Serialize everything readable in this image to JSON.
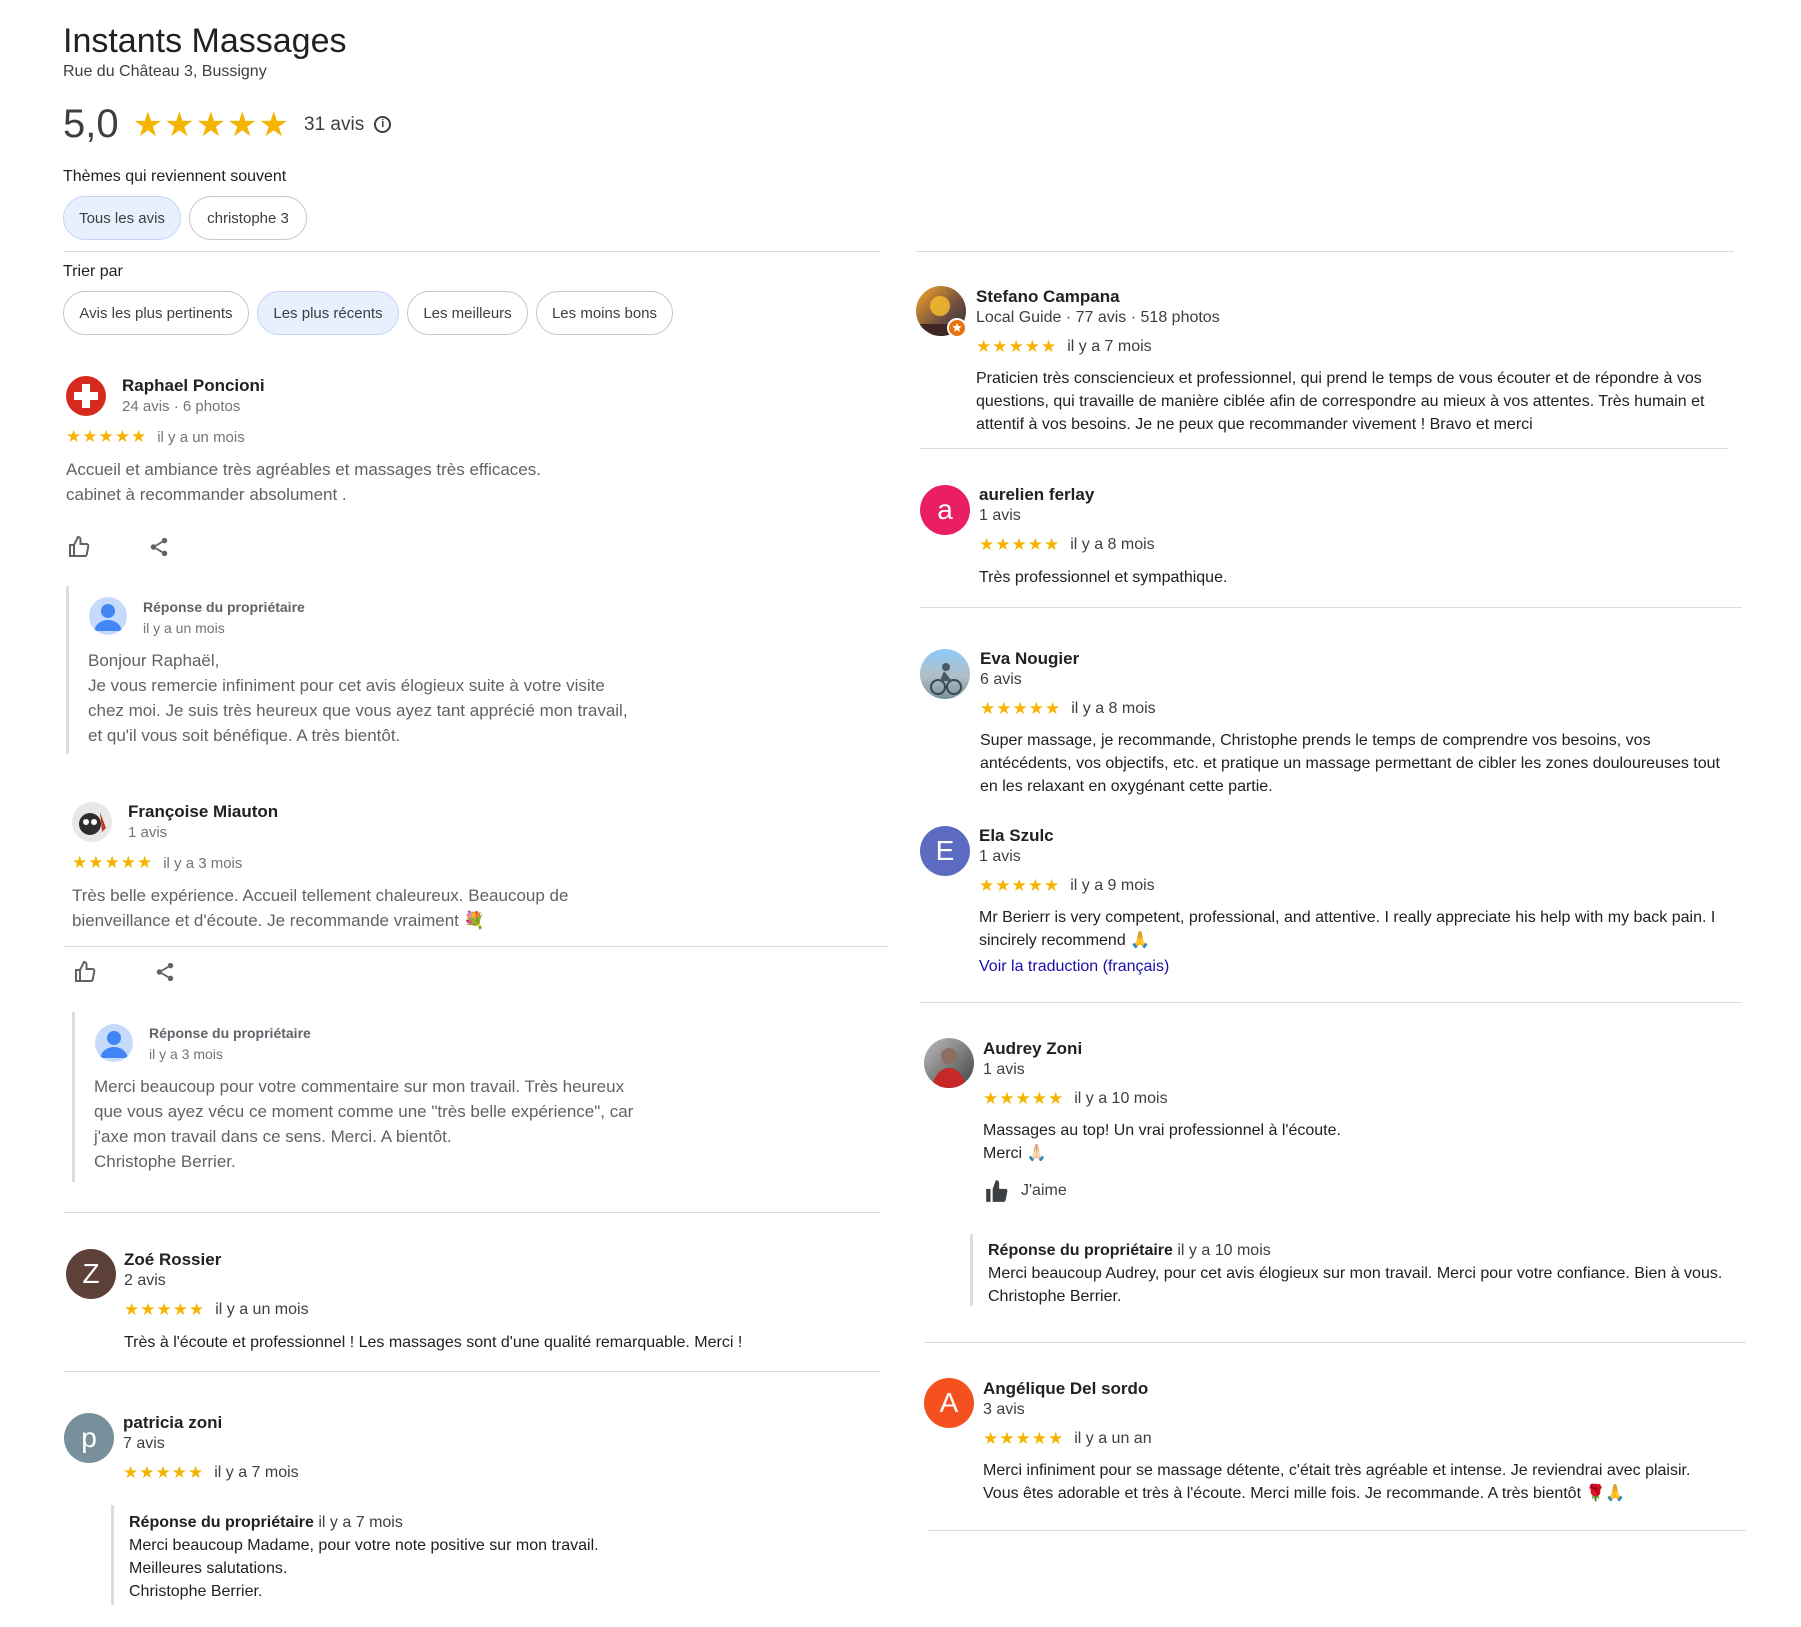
{
  "place": {
    "title": "Instants Massages",
    "address": "Rue du Château 3, Bussigny",
    "rating": "5,0",
    "stars": "★★★★★",
    "review_count": "31 avis",
    "info_icon": "info-icon"
  },
  "themes": {
    "label": "Thèmes qui reviennent souvent",
    "chips": [
      {
        "label": "Tous les avis",
        "selected": true
      },
      {
        "label": "christophe  3",
        "selected": false
      }
    ]
  },
  "sort": {
    "label": "Trier par",
    "options": [
      {
        "label": "Avis les plus pertinents",
        "selected": false
      },
      {
        "label": "Les plus récents",
        "selected": true
      },
      {
        "label": "Les meilleurs",
        "selected": false
      },
      {
        "label": "Les moins bons",
        "selected": false
      }
    ]
  },
  "reviews_left": [
    {
      "name": "Raphael Poncioni",
      "meta": "24 avis · 6 photos",
      "stars": "★★★★★",
      "when": "il y a un mois",
      "text": [
        "Accueil et ambiance très agréables et massages très efficaces.",
        "cabinet à recommander absolument ."
      ],
      "avatar_icon": "swiss-flag-avatar",
      "reply": {
        "title": "Réponse du propriétaire",
        "when": "il y a un mois",
        "text": [
          "Bonjour Raphaël,",
          "Je vous remercie infiniment pour cet avis élogieux suite à votre visite",
          "chez moi. Je suis très heureux que vous ayez tant apprécié mon travail,",
          "et qu'il vous soit bénéfique. A très bientôt."
        ]
      }
    },
    {
      "name": "Françoise Miauton",
      "meta": "1 avis",
      "stars": "★★★★★",
      "when": "il y a 3 mois",
      "text": [
        "Très belle expérience. Accueil tellement chaleureux. Beaucoup de",
        "bienveillance et d'écoute. Je recommande vraiment 💐"
      ],
      "avatar_icon": "photo-avatar",
      "reply": {
        "title": "Réponse du propriétaire",
        "when": "il y a 3 mois",
        "text": [
          "Merci beaucoup pour votre commentaire sur mon travail. Très heureux",
          "que vous ayez vécu ce moment comme une \"très belle expérience\", car",
          "j'axe mon travail dans ce sens. Merci. A bientôt.",
          "Christophe Berrier."
        ]
      }
    },
    {
      "name": "Zoé Rossier",
      "meta": "2 avis",
      "stars": "★★★★★",
      "when": "il y a un mois",
      "initial": "Z",
      "text": [
        "Très à l'écoute et professionnel ! Les massages sont d'une qualité remarquable. Merci !"
      ]
    },
    {
      "name": "patricia zoni",
      "meta": "7 avis",
      "stars": "★★★★★",
      "when": "il y a 7 mois",
      "initial": "p",
      "reply": {
        "title": "Réponse du propriétaire",
        "when": "il y a 7 mois",
        "text": [
          "Merci beaucoup Madame, pour votre note positive sur mon travail.",
          "Meilleures salutations.",
          "Christophe Berrier."
        ]
      }
    }
  ],
  "reviews_right": [
    {
      "name": "Stefano Campana",
      "meta": "Local Guide · 77 avis · 518 photos",
      "stars": "★★★★★",
      "when": "il y a 7 mois",
      "text": [
        "Praticien très consciencieux et professionnel, qui prend le temps de vous écouter et de répondre à vos",
        "questions, qui travaille de manière ciblée afin de correspondre au mieux à vos attentes. Très humain et",
        "attentif à vos besoins. Je ne peux que recommander vivement ! Bravo et merci"
      ]
    },
    {
      "name": "aurelien ferlay",
      "meta": "1 avis",
      "stars": "★★★★★",
      "when": "il y a 8 mois",
      "initial": "a",
      "text": [
        "Très professionnel et sympathique."
      ]
    },
    {
      "name": "Eva Nougier",
      "meta": "6 avis",
      "stars": "★★★★★",
      "when": "il y a 8 mois",
      "text": [
        "Super massage, je recommande, Christophe prends le temps de comprendre vos besoins, vos",
        "antécédents, vos objectifs, etc. et pratique un massage permettant de cibler les zones douloureuses tout",
        "en les relaxant en oxygénant cette partie."
      ]
    },
    {
      "name": "Ela Szulc",
      "meta": "1 avis",
      "stars": "★★★★★",
      "when": "il y a 9 mois",
      "initial": "E",
      "text": [
        "Mr Berierr is very competent, professional, and attentive. I really appreciate his help with my back pain. I",
        "sincirely recommend 🙏"
      ],
      "translate_link": "Voir la traduction (français)"
    },
    {
      "name": "Audrey Zoni",
      "meta": "1 avis",
      "stars": "★★★★★",
      "when": "il y a 10 mois",
      "text": [
        "Massages au top! Un vrai professionnel à l'écoute.",
        "Merci 🙏🏻"
      ],
      "like_label": "J'aime",
      "reply": {
        "title": "Réponse du propriétaire",
        "when": "il y a 10 mois",
        "text": [
          "Merci beaucoup Audrey, pour cet avis élogieux sur mon travail. Merci pour votre confiance. Bien à vous.",
          "Christophe Berrier."
        ]
      }
    },
    {
      "name": "Angélique Del sordo",
      "meta": "3 avis",
      "stars": "★★★★★",
      "when": "il y a un an",
      "initial": "A",
      "text": [
        "Merci infiniment pour se massage détente, c'était très agréable et intense. Je reviendrai avec plaisir.",
        "Vous êtes adorable et très à l'écoute. Merci mille fois. Je recommande. A très bientôt 🌹🙏"
      ]
    }
  ],
  "colors": {
    "star": "#f4b400",
    "chip_selected": "#e8f0fe",
    "avatar_z": "#5d4037",
    "avatar_p": "#78909c",
    "avatar_a": "#e91e63",
    "avatar_e": "#5c6bc0",
    "avatar_A": "#f4511e"
  }
}
